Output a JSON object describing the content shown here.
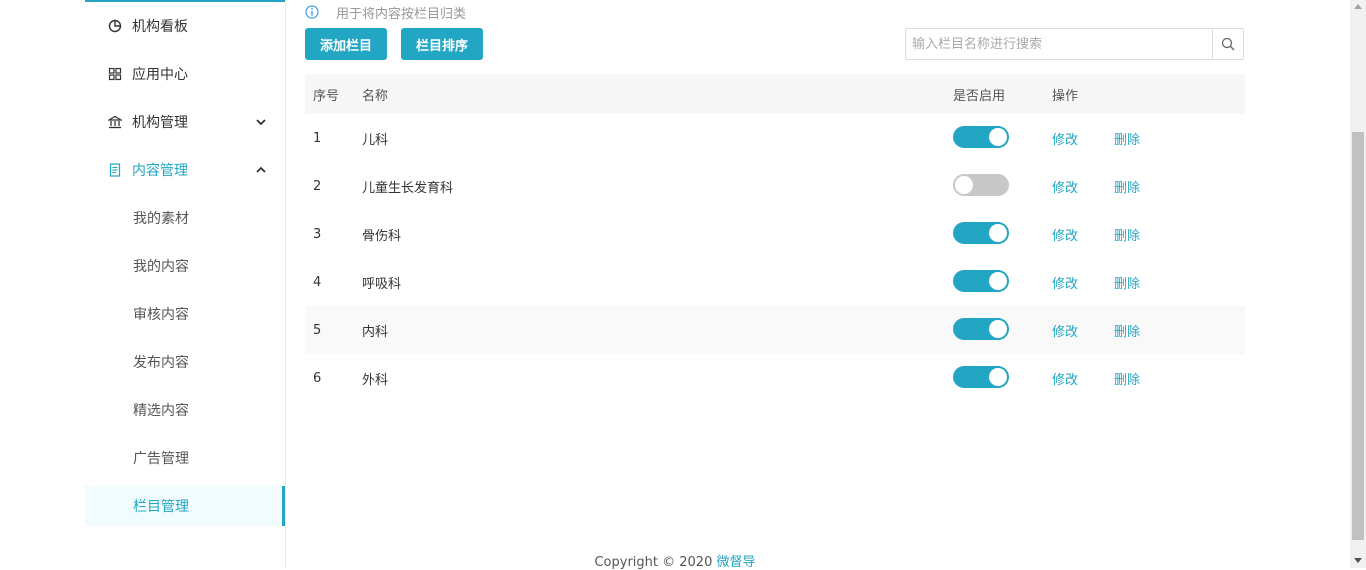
{
  "sidebar": {
    "items": [
      {
        "label": "机构看板",
        "icon": "pie-chart-icon"
      },
      {
        "label": "应用中心",
        "icon": "grid-icon"
      },
      {
        "label": "机构管理",
        "icon": "bank-icon"
      },
      {
        "label": "内容管理",
        "icon": "document-icon"
      }
    ],
    "sub_items": [
      {
        "label": "我的素材"
      },
      {
        "label": "我的内容"
      },
      {
        "label": "审核内容"
      },
      {
        "label": "发布内容"
      },
      {
        "label": "精选内容"
      },
      {
        "label": "广告管理"
      },
      {
        "label": "栏目管理"
      }
    ]
  },
  "main": {
    "hint": "用于将内容按栏目归类",
    "add_button": "添加栏目",
    "sort_button": "栏目排序",
    "search": {
      "placeholder": "输入栏目名称进行搜索",
      "value": ""
    },
    "table": {
      "headers": {
        "index": "序号",
        "name": "名称",
        "enabled": "是否启用",
        "actions": "操作"
      },
      "edit_label": "修改",
      "delete_label": "删除",
      "rows": [
        {
          "index": "1",
          "name": "儿科",
          "enabled": true
        },
        {
          "index": "2",
          "name": "儿童生长发育科",
          "enabled": false
        },
        {
          "index": "3",
          "name": "骨伤科",
          "enabled": true
        },
        {
          "index": "4",
          "name": "呼吸科",
          "enabled": true
        },
        {
          "index": "5",
          "name": "内科",
          "enabled": true
        },
        {
          "index": "6",
          "name": "外科",
          "enabled": true
        }
      ]
    }
  },
  "footer": {
    "text": "Copyright © 2020",
    "brand": "微督导"
  },
  "colors": {
    "accent": "#22a6c4",
    "toggle_off": "#c8c8c8"
  }
}
